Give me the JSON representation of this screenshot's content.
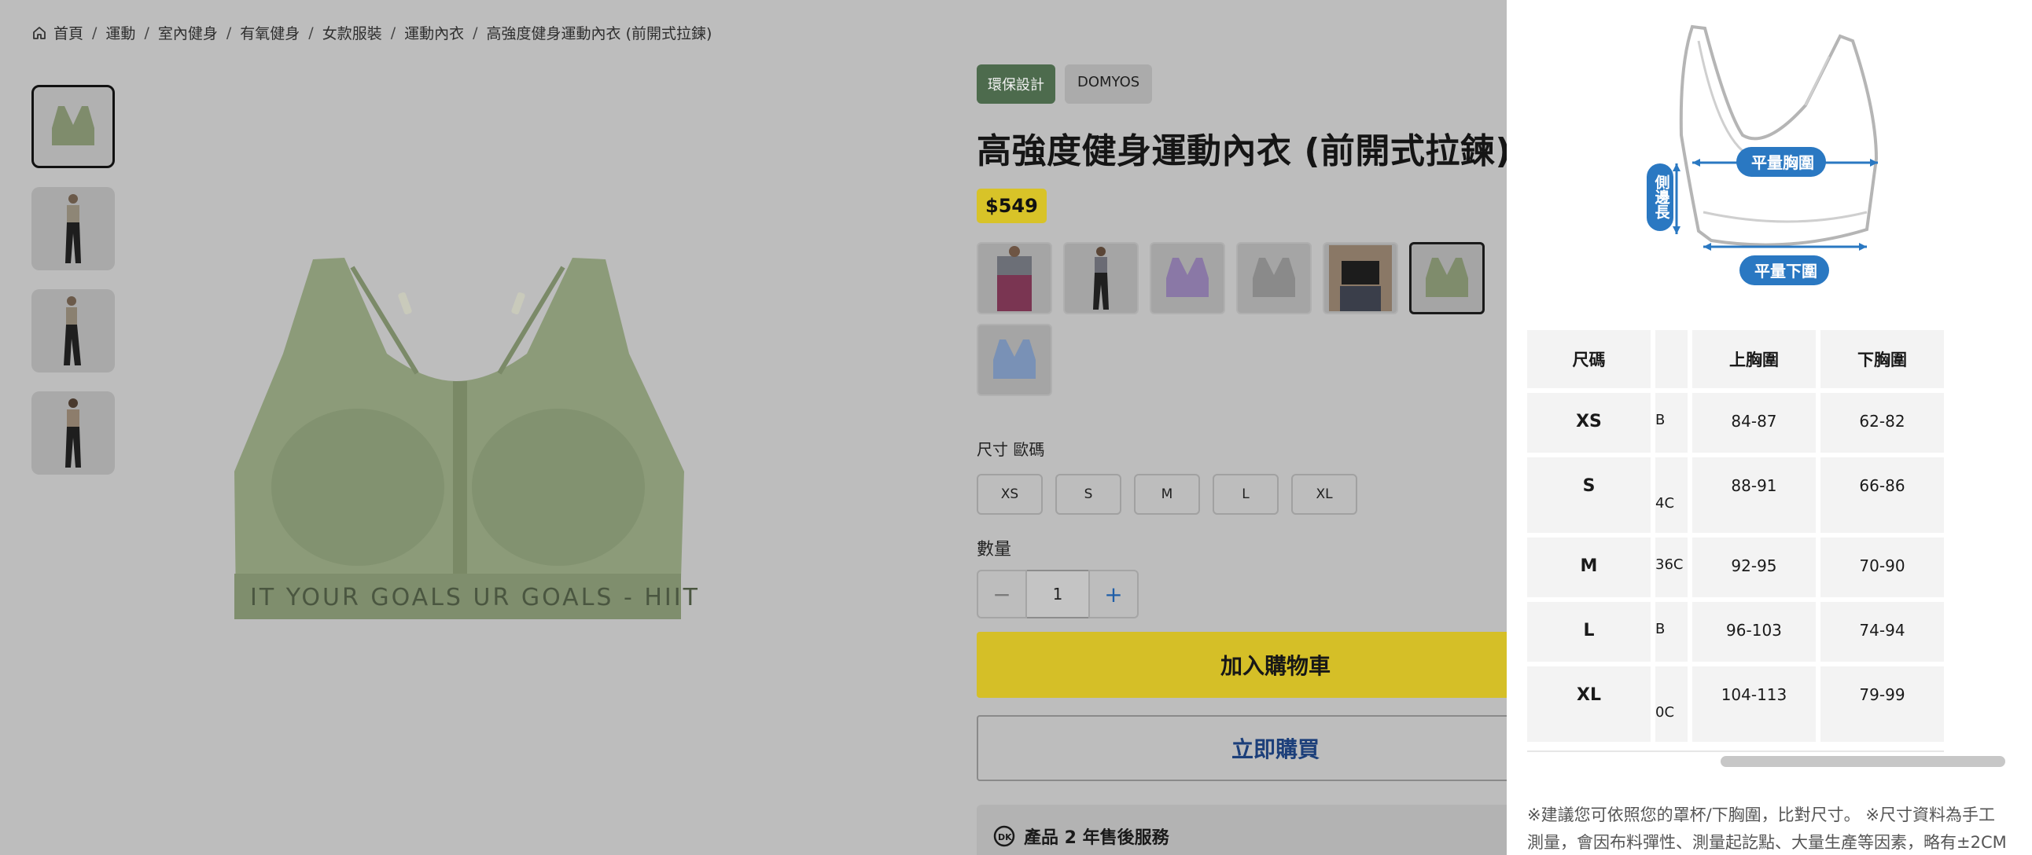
{
  "breadcrumb": [
    "首頁",
    "運動",
    "室內健身",
    "有氧健身",
    "女款服裝",
    "運動內衣",
    "高強度健身運動內衣 (前開式拉鍊)"
  ],
  "product": {
    "tag_eco": "環保設計",
    "tag_brand": "DOMYOS",
    "title": "高強度健身運動內衣 (前開式拉鍊)",
    "price": "$549",
    "band_text": "IT YOUR GOALS  UR GOALS - HIIT",
    "colors": {
      "green": "#8a9a78",
      "yellow_cta": "#d5bf27"
    }
  },
  "size_section": {
    "label": "尺寸 歐碼",
    "sizes": [
      "XS",
      "S",
      "M",
      "L",
      "XL"
    ]
  },
  "quantity": {
    "label": "數量",
    "value": "1",
    "minus": "−",
    "plus": "+"
  },
  "actions": {
    "add_to_cart": "加入購物車",
    "buy_now": "立即購買"
  },
  "service": {
    "label": "產品 2 年售後服務"
  },
  "size_guide": {
    "diagram_labels": {
      "side": "側邊長",
      "chest": "平量胸圍",
      "under": "平量下圍"
    },
    "headers": [
      "尺碼",
      "",
      "上胸圍",
      "下胸圍"
    ],
    "rows": [
      {
        "size": "XS",
        "cup": "B",
        "bust": "84-87",
        "under": "62-82"
      },
      {
        "size": "S",
        "cup": "4C",
        "bust": "88-91",
        "under": "66-86"
      },
      {
        "size": "M",
        "cup": "36C",
        "bust": "92-95",
        "under": "70-90"
      },
      {
        "size": "L",
        "cup": "B",
        "bust": "96-103",
        "under": "74-94"
      },
      {
        "size": "XL",
        "cup": "0C",
        "bust": "104-113",
        "under": "79-99"
      }
    ],
    "note": "※建議您可依照您的罩杯/下胸圍，比對尺寸。 ※尺寸資料為手工測量，會因布料彈性、測量起訖點、大量生產等因素，略有±2CM"
  }
}
